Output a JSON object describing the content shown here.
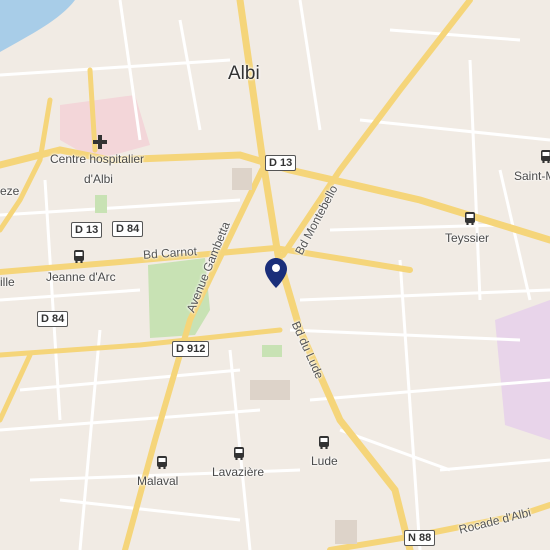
{
  "map": {
    "city": "Albi",
    "hospital": [
      "Centre hospitalier",
      "d'Albi"
    ],
    "streets": {
      "carnot": "Bd Carnot",
      "gambetta": "Avenue Gambetta",
      "montebello": "Bd Montebello",
      "lude": "Bd du Lude",
      "rocade": "Rocade d'Albi"
    },
    "shields": {
      "d13_top": "D 13",
      "d13_left": "D 13",
      "d84_top": "D 84",
      "d84_left": "D 84",
      "d912": "D 912",
      "n88": "N 88"
    },
    "stops": {
      "jeanne": "Jeanne d'Arc",
      "teyssier": "Teyssier",
      "saint": "Saint-M",
      "lude": "Lude",
      "lavaziere": "Lavazière",
      "malaval": "Malaval"
    },
    "edge_labels": {
      "eze": "eze",
      "ille": "ille"
    },
    "colors": {
      "background": "#f1ebe4",
      "major_road": "#f5d57a",
      "minor_road": "#ffffff",
      "park": "#c8e2b4",
      "water": "#a8cde8",
      "hospital": "#f3d6d9",
      "industrial": "#e8d4ea",
      "pin": "#1a2e7a"
    },
    "icons": [
      "bus-stop-icon",
      "hospital-cross-icon",
      "location-pin-icon"
    ]
  }
}
